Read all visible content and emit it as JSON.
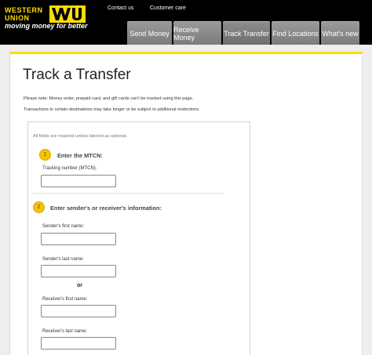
{
  "brand": {
    "line1": "WESTERN",
    "line2": "UNION",
    "mark": "WU",
    "tagline": "moving money for better",
    "colors": {
      "brand_yellow": "#ffdd00",
      "header_bg": "#000000",
      "tab_gray": "#8a8a8a",
      "step_yellow": "#f5c400"
    }
  },
  "header_links": {
    "contact": "Contact us",
    "customer_care": "Customer care"
  },
  "nav": {
    "tabs": [
      {
        "label": "Send Money"
      },
      {
        "label": "Receive Money"
      },
      {
        "label": "Track Transfer",
        "active": true
      },
      {
        "label": "Find Locations"
      },
      {
        "label": "What's new"
      }
    ]
  },
  "page": {
    "title": "Track a Transfer",
    "notice1": "Please note: Money order, prepaid card, and gift cards can't be tracked using this page.",
    "notice2": "Transactions to certain destinations may take longer or be subject to additional restrictions."
  },
  "form": {
    "required_note": "All fields are required unless labeled as optional.",
    "step1": {
      "number": "1",
      "title": "Enter the MTCN:",
      "field_label": "Tracking number (MTCN):",
      "value": ""
    },
    "step2": {
      "number": "2",
      "title": "Enter sender's or receiver's information:",
      "sender_first_label": "Sender's first name:",
      "sender_last_label": "Sender's last name:",
      "or_label": "or",
      "receiver_first_label": "Receiver's first name:",
      "receiver_last_label": "Receiver's last name:"
    }
  }
}
